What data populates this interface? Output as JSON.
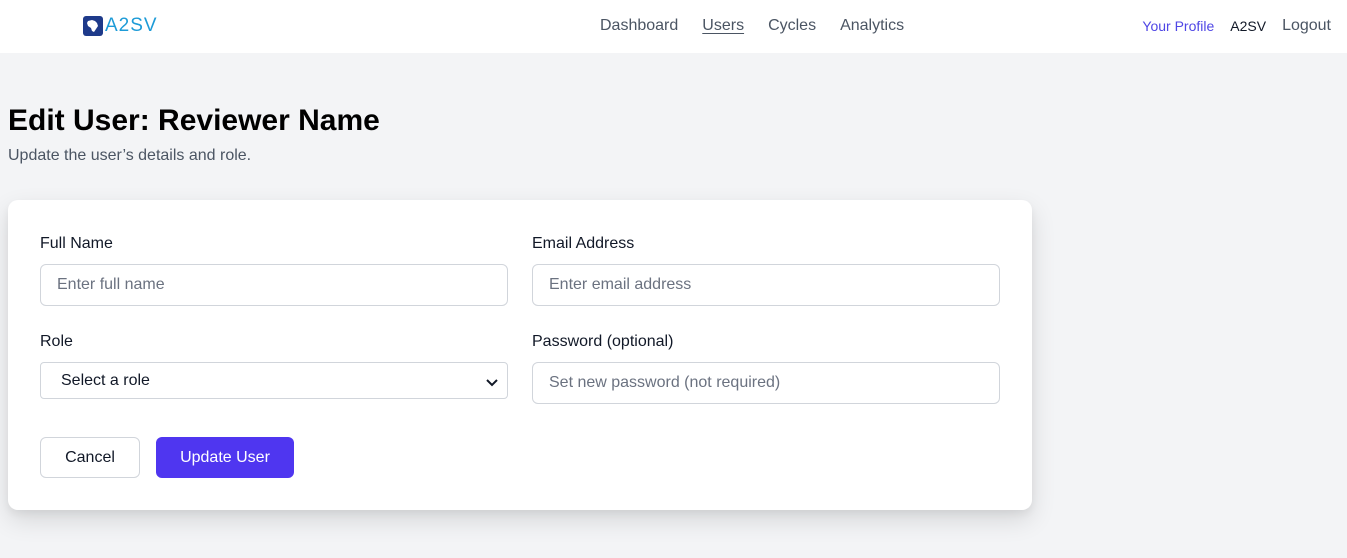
{
  "header": {
    "logo_text": "A2SV",
    "nav": [
      {
        "label": "Dashboard",
        "active": false
      },
      {
        "label": "Users",
        "active": true
      },
      {
        "label": "Cycles",
        "active": false
      },
      {
        "label": "Analytics",
        "active": false
      }
    ],
    "profile_label": "Your Profile",
    "user_name": "A2SV",
    "logout_label": "Logout"
  },
  "page": {
    "title": "Edit User: Reviewer Name",
    "subtitle": "Update the user’s details and role."
  },
  "form": {
    "full_name": {
      "label": "Full Name",
      "placeholder": "Enter full name",
      "value": ""
    },
    "email": {
      "label": "Email Address",
      "placeholder": "Enter email address",
      "value": ""
    },
    "role": {
      "label": "Role",
      "selected": "Select a role"
    },
    "password": {
      "label": "Password (optional)",
      "placeholder": "Set new password (not required)",
      "value": ""
    },
    "cancel_label": "Cancel",
    "submit_label": "Update User"
  },
  "colors": {
    "accent": "#4f46e5",
    "primary_button": "#4f36f0",
    "logo_text": "#1d9bd7",
    "logo_mark": "#1e3a8a",
    "page_background": "#f3f4f6"
  }
}
